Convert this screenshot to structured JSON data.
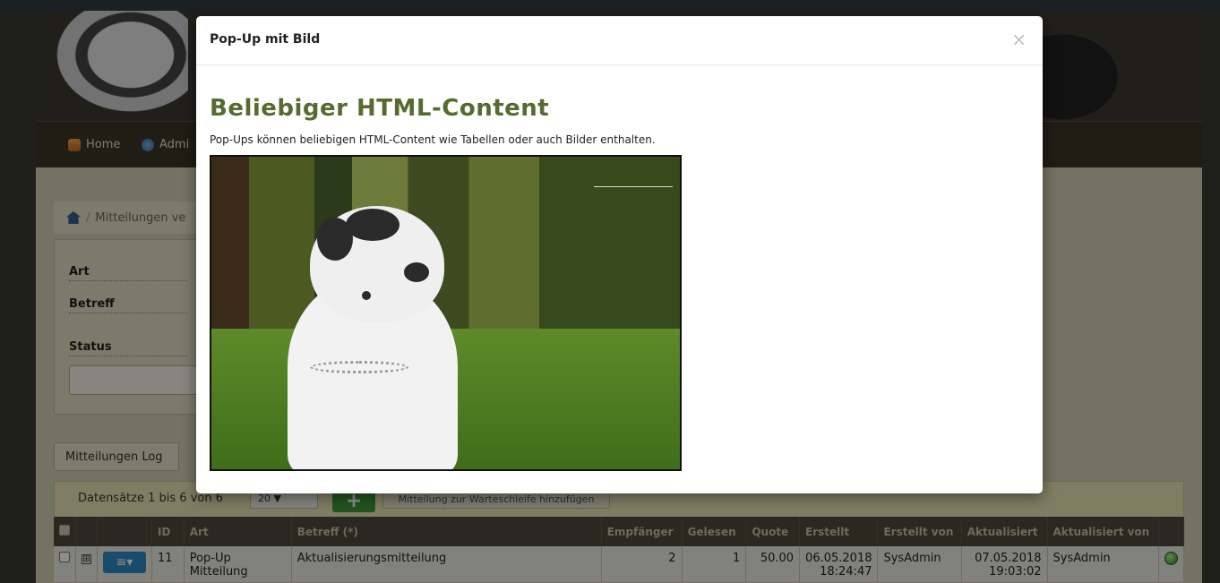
{
  "nav": {
    "home_label": "Home",
    "admin_label": "Admi"
  },
  "breadcrumb": {
    "text": "Mitteilungen ve"
  },
  "filter": {
    "art_label": "Art",
    "betreff_label": "Betreff",
    "status_label": "Status"
  },
  "log_button": "Mitteilungen Log",
  "records": {
    "summary": "Datensätze 1 bis 6 von 6",
    "page_size": "20 ▼",
    "add_label": "+",
    "queue_button": "Mitteilung zur Warteschleife hinzufügen"
  },
  "table": {
    "headers": [
      "ID",
      "Art",
      "Betreff (*)",
      "Empfänger",
      "Gelesen",
      "Quote",
      "Erstellt",
      "Erstellt von",
      "Aktualisiert",
      "Aktualisiert von"
    ],
    "rows": [
      {
        "id": "11",
        "art": "Pop-Up Mitteilung",
        "betreff": "Aktualisierungsmitteilung",
        "empfaenger": "2",
        "gelesen": "1",
        "quote": "50.00",
        "erstellt_date": "06.05.2018",
        "erstellt_time": "18:24:47",
        "erstellt_von": "SysAdmin",
        "aktualisiert_date": "07.05.2018",
        "aktualisiert_time": "19:03:02",
        "aktualisiert_von": "SysAdmin",
        "expand_symbol": "⊞",
        "menu_symbol": "≡▾"
      }
    ]
  },
  "modal": {
    "title": "Pop-Up mit Bild",
    "close_symbol": "×",
    "heading": "Beliebiger HTML-Content",
    "description": "Pop-Ups können beliebigen HTML-Content wie Tabellen oder auch Bilder enthalten."
  },
  "colors": {
    "heading_green": "#566b2f",
    "nav_bg": "#3a3526",
    "menu_blue": "#2e8bc2",
    "add_green": "#3f9a3a"
  }
}
